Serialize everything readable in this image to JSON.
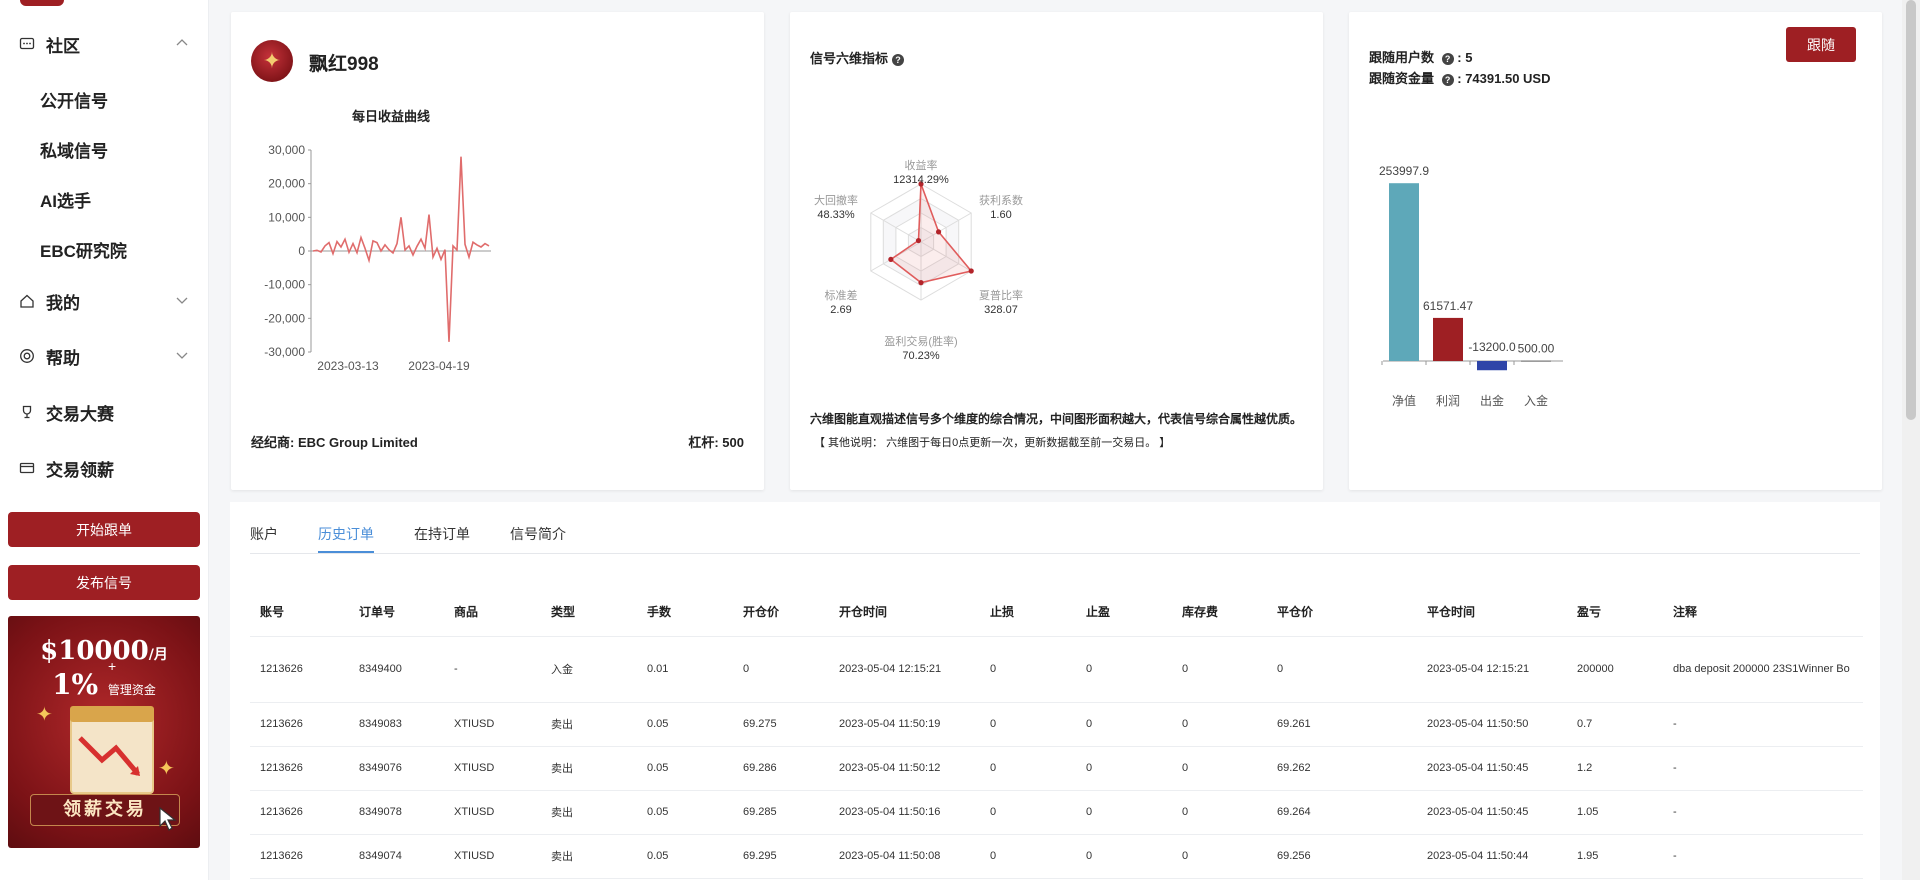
{
  "sidebar": {
    "sections": [
      {
        "label": "社区",
        "icon": "chat-icon"
      },
      {
        "label": "我的",
        "icon": "home-icon"
      },
      {
        "label": "帮助",
        "icon": "lifebuoy-icon"
      },
      {
        "label": "交易大赛",
        "icon": "trophy-icon"
      },
      {
        "label": "交易领薪",
        "icon": "card-icon"
      }
    ],
    "community_items": [
      "公开信号",
      "私域信号",
      "AI选手",
      "EBC研究院"
    ],
    "start_follow": "开始跟单",
    "publish_signal": "发布信号",
    "promo": {
      "amount": "$10000",
      "per_month": "/月",
      "plus": "+",
      "percent": "1%",
      "mgmt": "管理资金",
      "cta": "领薪交易"
    }
  },
  "profile": {
    "name": "飘红998",
    "chart_title": "每日收益曲线",
    "broker": "经纪商: EBC Group Limited",
    "leverage": "杠杆: 500"
  },
  "chart_data": [
    {
      "type": "line",
      "title": "每日收益曲线",
      "x_ticks": [
        "2023-03-13",
        "2023-04-19"
      ],
      "y_ticks": [
        "30,000",
        "20,000",
        "10,000",
        "0",
        "-10,000",
        "-20,000",
        "-30,000"
      ],
      "ylim": [
        -30000,
        30000
      ],
      "series": [
        {
          "color": "#e06c6c",
          "values": [
            0,
            200,
            -300,
            1500,
            2500,
            -800,
            2800,
            1200,
            3500,
            -400,
            2200,
            -500,
            4000,
            800,
            -2800,
            3000,
            2500,
            0,
            1800,
            400,
            -600,
            2200,
            10000,
            300,
            1500,
            -1200,
            1400,
            3500,
            800,
            10800,
            -1800,
            800,
            -2500,
            400,
            -27000,
            1500,
            300,
            28000,
            2000,
            -1800,
            2600,
            1800,
            1200,
            2200,
            1500
          ]
        }
      ]
    },
    {
      "type": "radar",
      "indicators": [
        {
          "name": "收益率",
          "value": "12314.29%",
          "score": 1.0
        },
        {
          "name": "获利系数",
          "value": "1.60",
          "score": 0.35
        },
        {
          "name": "夏普比率",
          "value": "328.07",
          "score": 1.0
        },
        {
          "name": "盈利交易(胜率)",
          "value": "70.23%",
          "score": 0.7
        },
        {
          "name": "标准差",
          "value": "2.69",
          "score": 0.6
        },
        {
          "name": "大回撤率",
          "value": "48.33%",
          "score": 0.05
        }
      ]
    },
    {
      "type": "bar",
      "categories": [
        "净值",
        "利润",
        "出金",
        "入金"
      ],
      "values": [
        253997.9,
        61571.47,
        -13200.0,
        500.0
      ],
      "value_labels": [
        "253997.9",
        "61571.47",
        "-13200.0",
        "500.00"
      ],
      "colors": [
        "#5ea8b9",
        "#9e1f23",
        "#2f45a8",
        "#666666"
      ],
      "ylim": [
        -20000,
        260000
      ]
    }
  ],
  "radar": {
    "title": "信号六维指标",
    "desc": "六维图能直观描述信号多个维度的综合情况，中间图形面积越大，代表信号综合属性越优质。",
    "note": "【 其他说明： 六维图于每日0点更新一次，更新数据截至前一交易日。 】"
  },
  "follow": {
    "users_label": "跟随用户数",
    "users_value": ": 5",
    "funds_label": "跟随资金量",
    "funds_value": ": 74391.50 USD",
    "button": "跟随"
  },
  "tabs": [
    "账户",
    "历史订单",
    "在持订单",
    "信号简介"
  ],
  "table": {
    "headers": [
      "账号",
      "订单号",
      "商品",
      "类型",
      "手数",
      "开仓价",
      "开仓时间",
      "止损",
      "止盈",
      "库存费",
      "平仓价",
      "平仓时间",
      "盈亏",
      "注释"
    ],
    "rows": [
      [
        "1213626",
        "8349400",
        "-",
        "入金",
        "0.01",
        "0",
        "2023-05-04 12:15:21",
        "0",
        "0",
        "0",
        "0",
        "2023-05-04 12:15:21",
        "200000",
        "dba deposit 200000 23S1Winner Bo"
      ],
      [
        "1213626",
        "8349083",
        "XTIUSD",
        "卖出",
        "0.05",
        "69.275",
        "2023-05-04 11:50:19",
        "0",
        "0",
        "0",
        "69.261",
        "2023-05-04 11:50:50",
        "0.7",
        "-"
      ],
      [
        "1213626",
        "8349076",
        "XTIUSD",
        "卖出",
        "0.05",
        "69.286",
        "2023-05-04 11:50:12",
        "0",
        "0",
        "0",
        "69.262",
        "2023-05-04 11:50:45",
        "1.2",
        "-"
      ],
      [
        "1213626",
        "8349078",
        "XTIUSD",
        "卖出",
        "0.05",
        "69.285",
        "2023-05-04 11:50:16",
        "0",
        "0",
        "0",
        "69.264",
        "2023-05-04 11:50:45",
        "1.05",
        "-"
      ],
      [
        "1213626",
        "8349074",
        "XTIUSD",
        "卖出",
        "0.05",
        "69.295",
        "2023-05-04 11:50:08",
        "0",
        "0",
        "0",
        "69.256",
        "2023-05-04 11:50:44",
        "1.95",
        "-"
      ]
    ]
  }
}
